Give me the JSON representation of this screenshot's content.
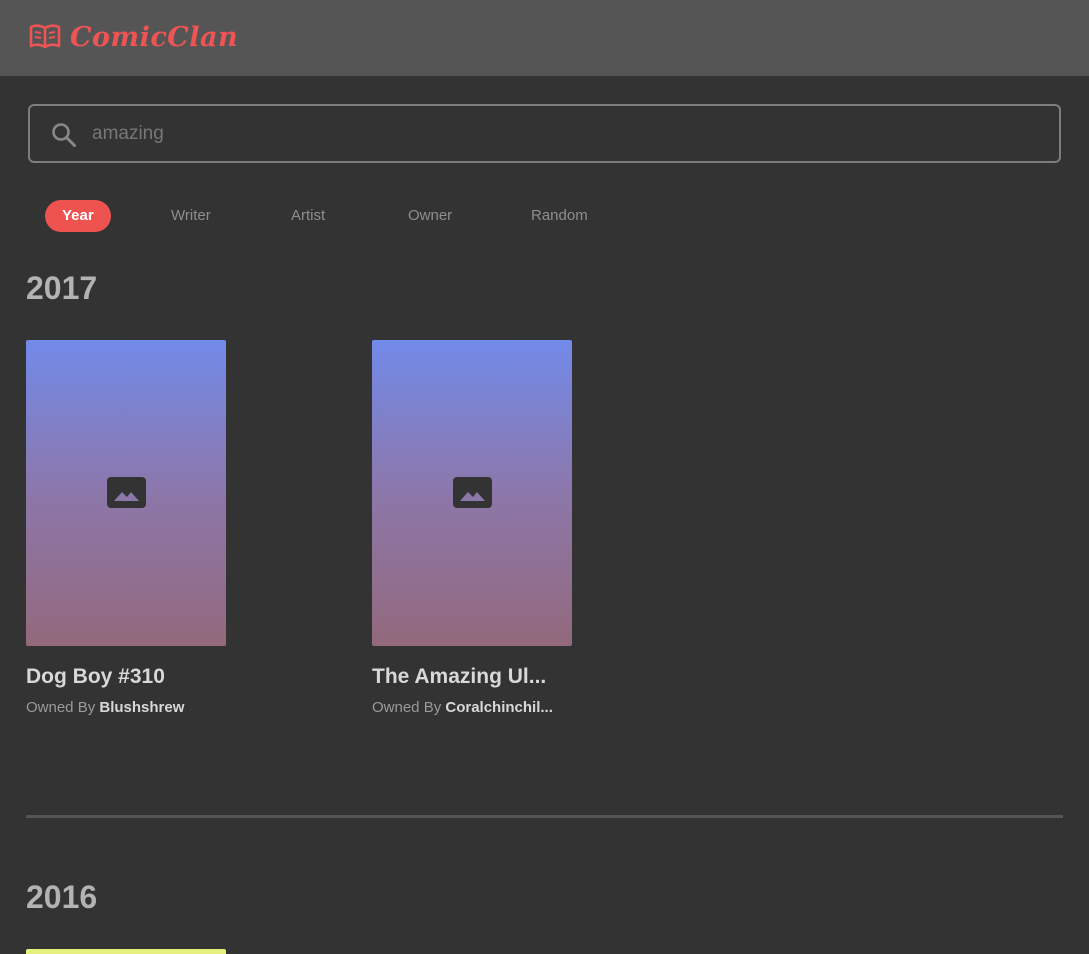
{
  "app": {
    "name": "ComicClan",
    "logo_icon": "open-book-icon",
    "brand_color": "#ef5454"
  },
  "search": {
    "value": "",
    "placeholder": "amazing",
    "icon": "search-icon"
  },
  "tabs": [
    {
      "label": "Year",
      "active": true
    },
    {
      "label": "Writer",
      "active": false
    },
    {
      "label": "Artist",
      "active": false
    },
    {
      "label": "Owner",
      "active": false
    },
    {
      "label": "Random",
      "active": false
    }
  ],
  "sections": [
    {
      "year": "2017",
      "comics": [
        {
          "title": "Dog Boy #310",
          "owned_by_label": "Owned By",
          "owner": "Blushshrew"
        },
        {
          "title": "The Amazing Ul...",
          "owned_by_label": "Owned By",
          "owner": "Coralchinchil..."
        }
      ]
    },
    {
      "year": "2016",
      "comics": []
    }
  ]
}
